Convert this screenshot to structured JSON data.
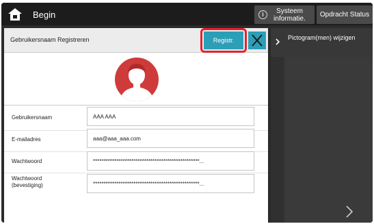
{
  "topbar": {
    "home_label": "Begin",
    "sysinfo_line1": "Systeem",
    "sysinfo_line2": "informatie.",
    "job_status_label": "Opdracht Status",
    "info_icon_glyph": "i"
  },
  "dialog": {
    "title": "Gebruikersnaam Registreren",
    "register_label": "Registr.",
    "accent_color": "#2b9fb7",
    "highlight_color": "#e8202e",
    "fields": [
      {
        "label": "Gebruikersnaam",
        "value": "AAA AAA"
      },
      {
        "label": "E-mailadres",
        "value": "aaa@aaa_aaa.com"
      },
      {
        "label": "Wachtwoord",
        "value": "**************************************************..."
      },
      {
        "label_line1": "Wachtwoord",
        "label_line2": "(bevestiging)",
        "value": "**************************************************..."
      }
    ]
  },
  "right_panel": {
    "header_label": "Pictogram(men) wijzigen"
  },
  "icons": {
    "home": "home-icon",
    "info": "info-icon",
    "close": "close-icon",
    "avatar": "user-avatar-icon",
    "chevron": "chevron-right-icon",
    "next": "next-arrow-icon"
  }
}
